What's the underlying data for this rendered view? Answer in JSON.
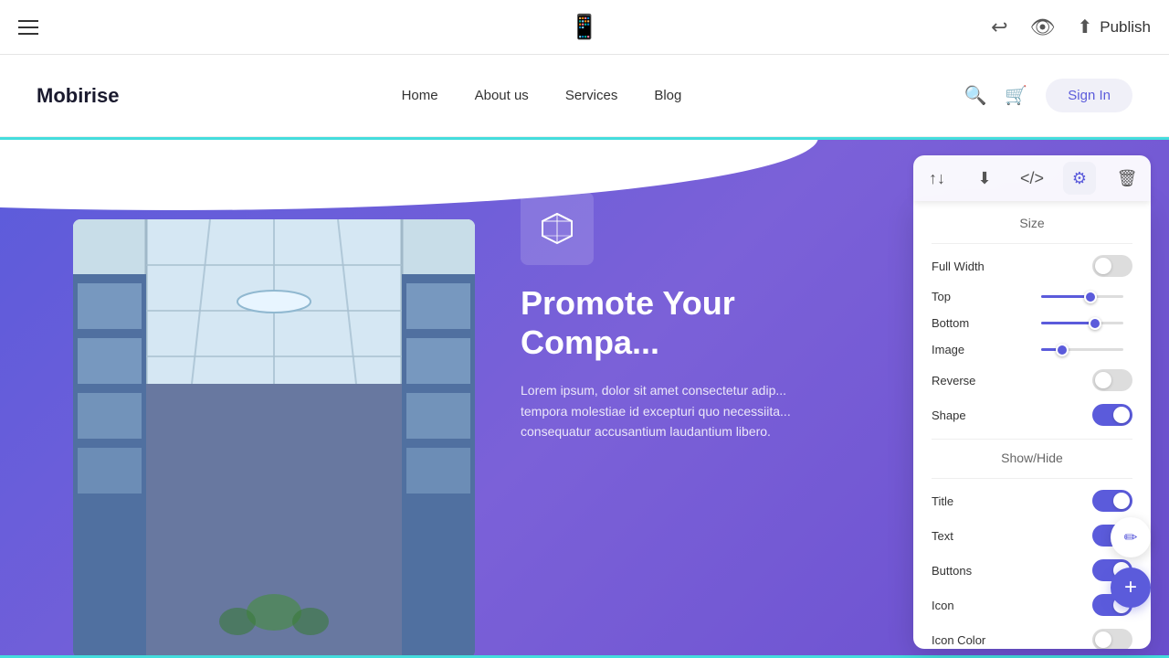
{
  "toolbar": {
    "publish_label": "Publish"
  },
  "nav": {
    "logo": "Mobirise",
    "links": [
      "Home",
      "About us",
      "Services",
      "Blog"
    ],
    "sign_in": "Sign In"
  },
  "hero": {
    "title": "Promote Your Compa...",
    "text": "Lorem ipsum, dolor sit amet consectetur adip... tempora molestiae id excepturi quo necessiita... consequatur accusantium laudantium libero.",
    "icon": "⬡"
  },
  "settings": {
    "panel_title": "Size",
    "show_hide_title": "Show/Hide",
    "rows": [
      {
        "label": "Full Width",
        "type": "toggle",
        "value": false
      },
      {
        "label": "Top",
        "type": "slider",
        "pct": 60
      },
      {
        "label": "Bottom",
        "type": "slider",
        "pct": 65
      },
      {
        "label": "Image",
        "type": "slider",
        "pct": 25
      },
      {
        "label": "Reverse",
        "type": "toggle",
        "value": false
      },
      {
        "label": "Shape",
        "type": "toggle",
        "value": true
      }
    ],
    "show_hide_rows": [
      {
        "label": "Title",
        "type": "toggle",
        "value": true
      },
      {
        "label": "Text",
        "type": "toggle",
        "value": true
      },
      {
        "label": "Buttons",
        "type": "toggle",
        "value": true
      },
      {
        "label": "Icon",
        "type": "toggle",
        "value": true
      },
      {
        "label": "Icon Color",
        "type": "toggle",
        "value": false
      }
    ]
  }
}
